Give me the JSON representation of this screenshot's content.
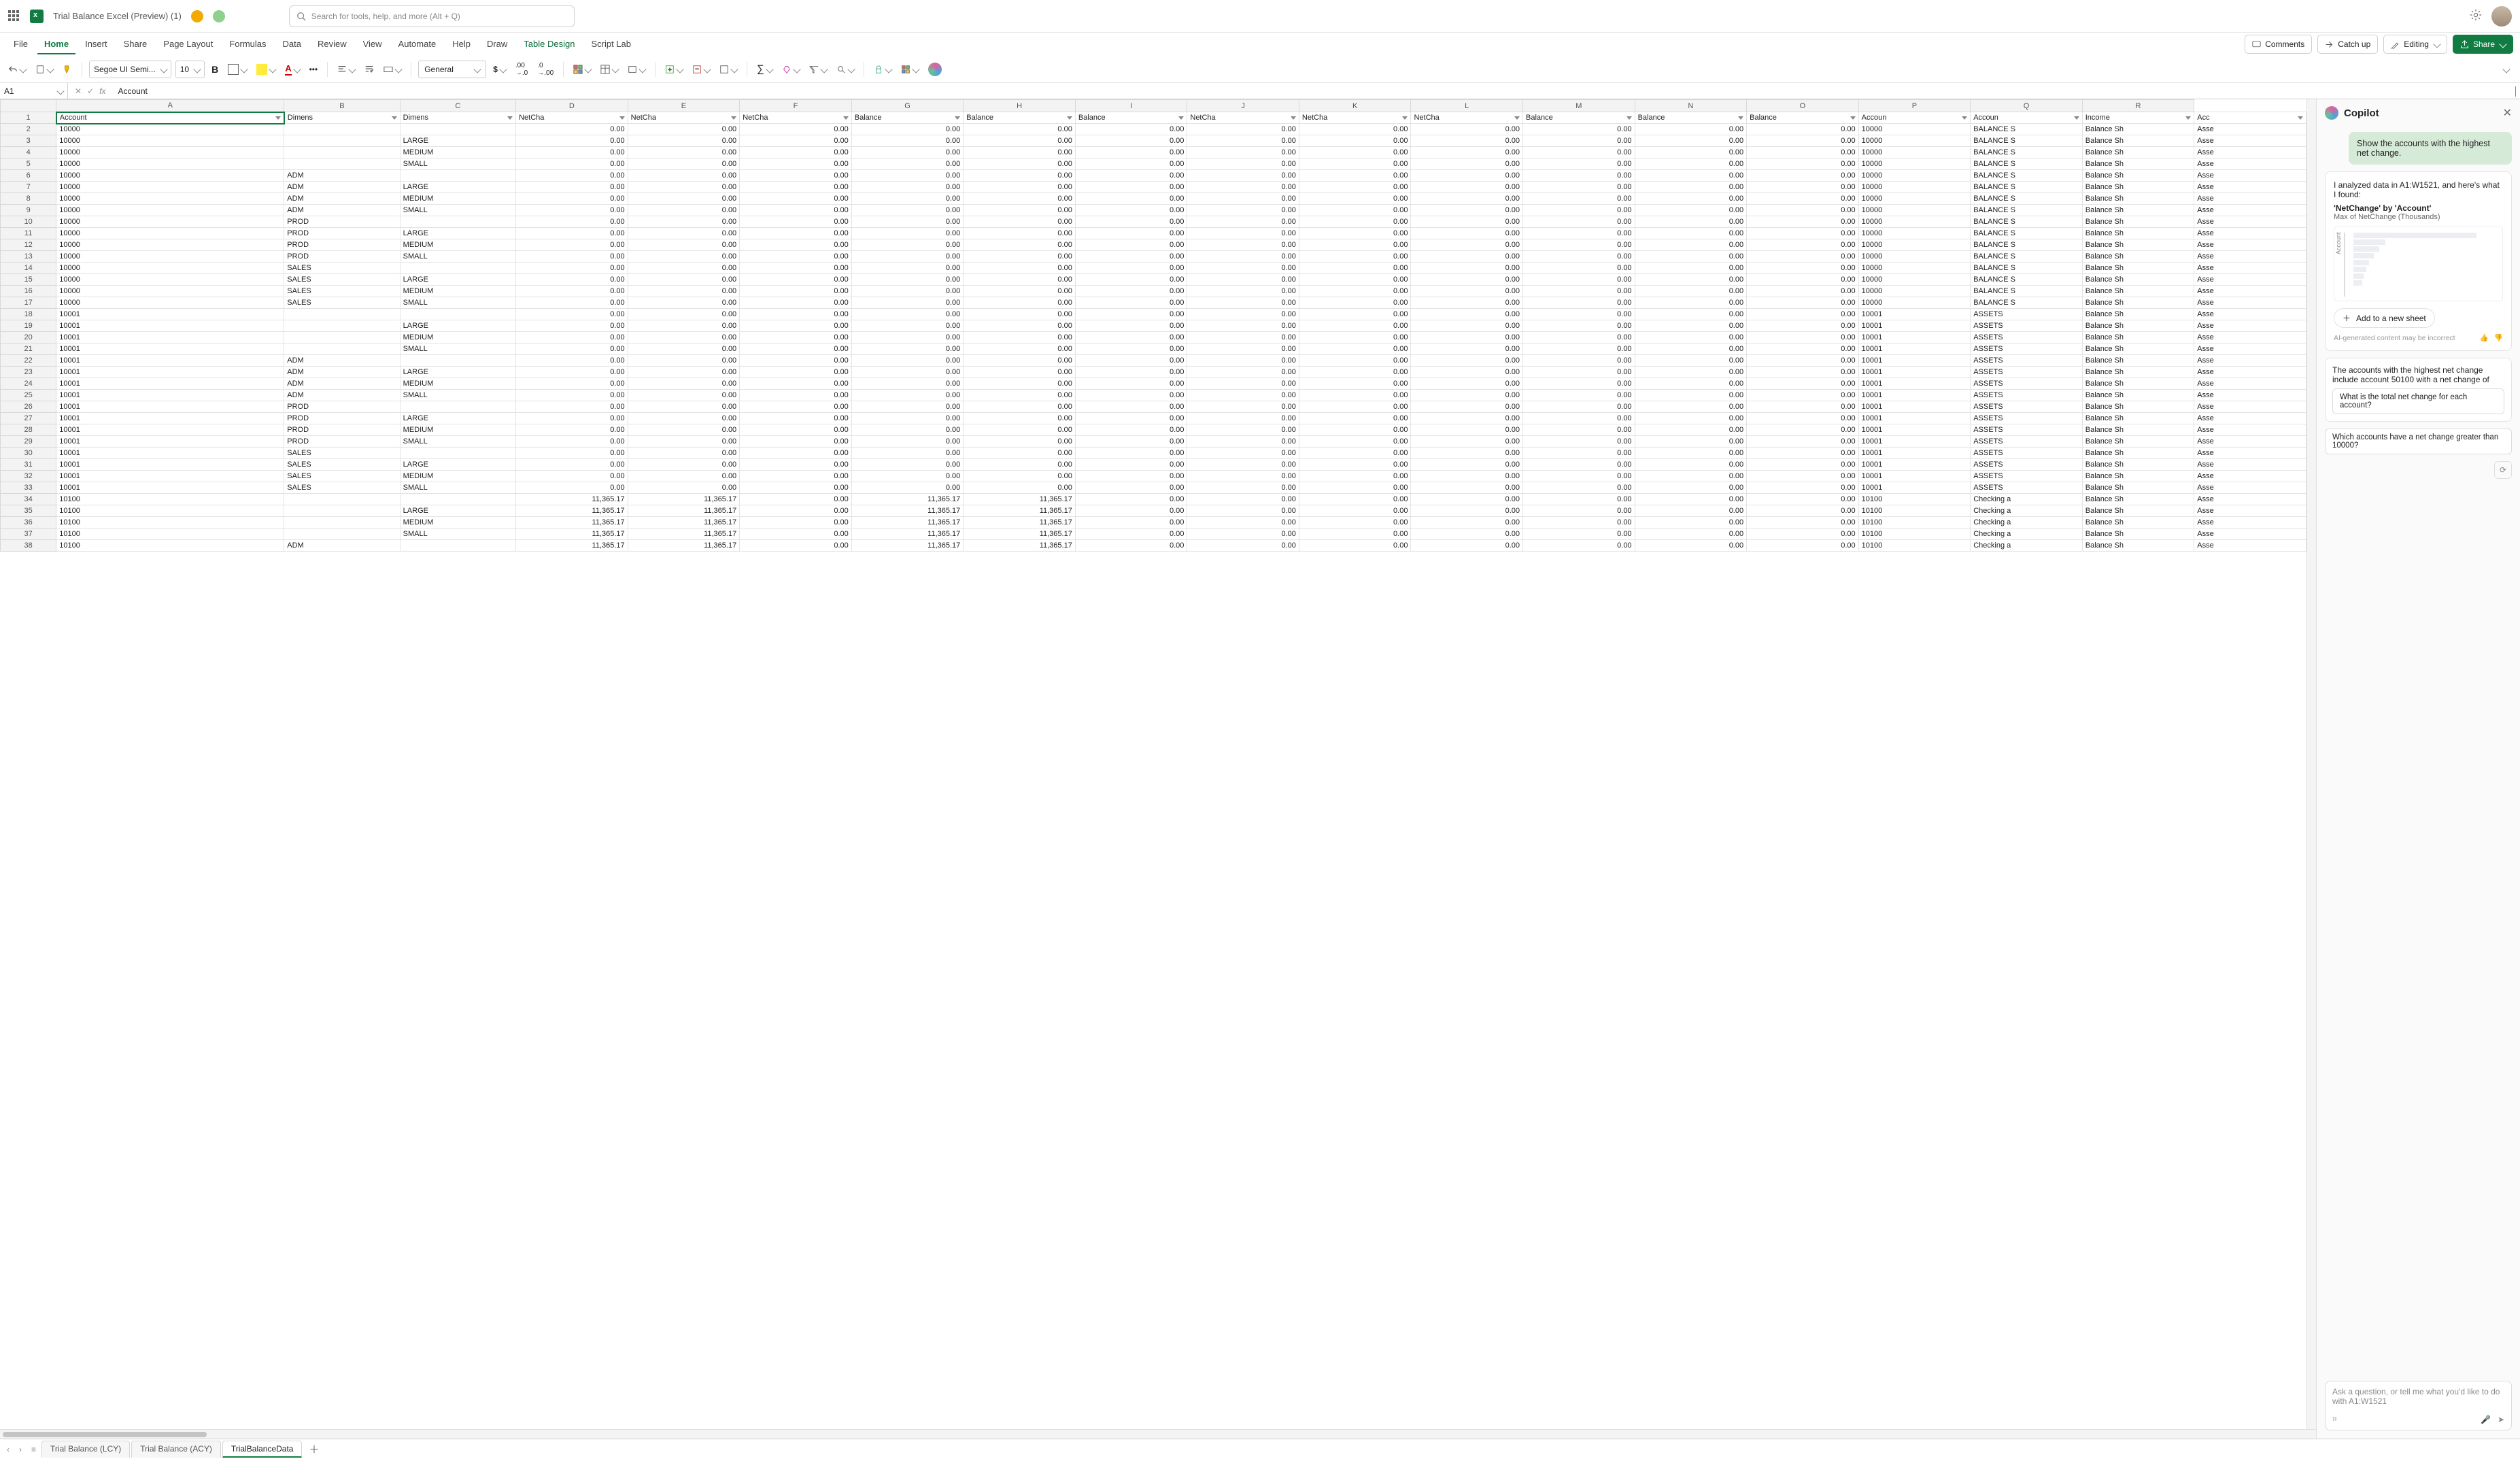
{
  "titlebar": {
    "doc_title": "Trial Balance Excel (Preview) (1)",
    "search_placeholder": "Search for tools, help, and more (Alt + Q)"
  },
  "ribbon": {
    "tabs": [
      "File",
      "Home",
      "Insert",
      "Share",
      "Page Layout",
      "Formulas",
      "Data",
      "Review",
      "View",
      "Automate",
      "Help",
      "Draw",
      "Table Design",
      "Script Lab"
    ],
    "active": "Home",
    "comments": "Comments",
    "catch_up": "Catch up",
    "editing": "Editing",
    "share": "Share"
  },
  "toolbar": {
    "font": "Segoe UI Semi...",
    "size": "10",
    "num_format": "General"
  },
  "fxbar": {
    "namebox": "A1",
    "formula": "Account"
  },
  "grid": {
    "cols": [
      "A",
      "B",
      "C",
      "D",
      "E",
      "F",
      "G",
      "H",
      "I",
      "J",
      "K",
      "L",
      "M",
      "N",
      "O",
      "P",
      "Q",
      "R"
    ],
    "header_row": [
      "Account",
      "Dimens",
      "Dimens",
      "NetCha",
      "NetCha",
      "NetCha",
      "Balance",
      "Balance",
      "Balance",
      "NetCha",
      "NetCha",
      "NetCha",
      "Balance",
      "Balance",
      "Balance",
      "Accoun",
      "Accoun",
      "Income",
      "Acc"
    ],
    "rows": [
      {
        "n": 2,
        "a": "10000",
        "b": "",
        "c": "",
        "p": "10000",
        "q": "BALANCE S",
        "r": "Balance Sh",
        "s": "Asse"
      },
      {
        "n": 3,
        "a": "10000",
        "b": "",
        "c": "LARGE",
        "p": "10000",
        "q": "BALANCE S",
        "r": "Balance Sh",
        "s": "Asse"
      },
      {
        "n": 4,
        "a": "10000",
        "b": "",
        "c": "MEDIUM",
        "p": "10000",
        "q": "BALANCE S",
        "r": "Balance Sh",
        "s": "Asse"
      },
      {
        "n": 5,
        "a": "10000",
        "b": "",
        "c": "SMALL",
        "p": "10000",
        "q": "BALANCE S",
        "r": "Balance Sh",
        "s": "Asse"
      },
      {
        "n": 6,
        "a": "10000",
        "b": "ADM",
        "c": "",
        "p": "10000",
        "q": "BALANCE S",
        "r": "Balance Sh",
        "s": "Asse"
      },
      {
        "n": 7,
        "a": "10000",
        "b": "ADM",
        "c": "LARGE",
        "p": "10000",
        "q": "BALANCE S",
        "r": "Balance Sh",
        "s": "Asse"
      },
      {
        "n": 8,
        "a": "10000",
        "b": "ADM",
        "c": "MEDIUM",
        "p": "10000",
        "q": "BALANCE S",
        "r": "Balance Sh",
        "s": "Asse"
      },
      {
        "n": 9,
        "a": "10000",
        "b": "ADM",
        "c": "SMALL",
        "p": "10000",
        "q": "BALANCE S",
        "r": "Balance Sh",
        "s": "Asse"
      },
      {
        "n": 10,
        "a": "10000",
        "b": "PROD",
        "c": "",
        "p": "10000",
        "q": "BALANCE S",
        "r": "Balance Sh",
        "s": "Asse"
      },
      {
        "n": 11,
        "a": "10000",
        "b": "PROD",
        "c": "LARGE",
        "p": "10000",
        "q": "BALANCE S",
        "r": "Balance Sh",
        "s": "Asse"
      },
      {
        "n": 12,
        "a": "10000",
        "b": "PROD",
        "c": "MEDIUM",
        "p": "10000",
        "q": "BALANCE S",
        "r": "Balance Sh",
        "s": "Asse"
      },
      {
        "n": 13,
        "a": "10000",
        "b": "PROD",
        "c": "SMALL",
        "p": "10000",
        "q": "BALANCE S",
        "r": "Balance Sh",
        "s": "Asse"
      },
      {
        "n": 14,
        "a": "10000",
        "b": "SALES",
        "c": "",
        "p": "10000",
        "q": "BALANCE S",
        "r": "Balance Sh",
        "s": "Asse"
      },
      {
        "n": 15,
        "a": "10000",
        "b": "SALES",
        "c": "LARGE",
        "p": "10000",
        "q": "BALANCE S",
        "r": "Balance Sh",
        "s": "Asse"
      },
      {
        "n": 16,
        "a": "10000",
        "b": "SALES",
        "c": "MEDIUM",
        "p": "10000",
        "q": "BALANCE S",
        "r": "Balance Sh",
        "s": "Asse"
      },
      {
        "n": 17,
        "a": "10000",
        "b": "SALES",
        "c": "SMALL",
        "p": "10000",
        "q": "BALANCE S",
        "r": "Balance Sh",
        "s": "Asse"
      },
      {
        "n": 18,
        "a": "10001",
        "b": "",
        "c": "",
        "p": "10001",
        "q": "ASSETS",
        "r": "Balance Sh",
        "s": "Asse"
      },
      {
        "n": 19,
        "a": "10001",
        "b": "",
        "c": "LARGE",
        "p": "10001",
        "q": "ASSETS",
        "r": "Balance Sh",
        "s": "Asse"
      },
      {
        "n": 20,
        "a": "10001",
        "b": "",
        "c": "MEDIUM",
        "p": "10001",
        "q": "ASSETS",
        "r": "Balance Sh",
        "s": "Asse"
      },
      {
        "n": 21,
        "a": "10001",
        "b": "",
        "c": "SMALL",
        "p": "10001",
        "q": "ASSETS",
        "r": "Balance Sh",
        "s": "Asse"
      },
      {
        "n": 22,
        "a": "10001",
        "b": "ADM",
        "c": "",
        "p": "10001",
        "q": "ASSETS",
        "r": "Balance Sh",
        "s": "Asse"
      },
      {
        "n": 23,
        "a": "10001",
        "b": "ADM",
        "c": "LARGE",
        "p": "10001",
        "q": "ASSETS",
        "r": "Balance Sh",
        "s": "Asse"
      },
      {
        "n": 24,
        "a": "10001",
        "b": "ADM",
        "c": "MEDIUM",
        "p": "10001",
        "q": "ASSETS",
        "r": "Balance Sh",
        "s": "Asse"
      },
      {
        "n": 25,
        "a": "10001",
        "b": "ADM",
        "c": "SMALL",
        "p": "10001",
        "q": "ASSETS",
        "r": "Balance Sh",
        "s": "Asse"
      },
      {
        "n": 26,
        "a": "10001",
        "b": "PROD",
        "c": "",
        "p": "10001",
        "q": "ASSETS",
        "r": "Balance Sh",
        "s": "Asse"
      },
      {
        "n": 27,
        "a": "10001",
        "b": "PROD",
        "c": "LARGE",
        "p": "10001",
        "q": "ASSETS",
        "r": "Balance Sh",
        "s": "Asse"
      },
      {
        "n": 28,
        "a": "10001",
        "b": "PROD",
        "c": "MEDIUM",
        "p": "10001",
        "q": "ASSETS",
        "r": "Balance Sh",
        "s": "Asse"
      },
      {
        "n": 29,
        "a": "10001",
        "b": "PROD",
        "c": "SMALL",
        "p": "10001",
        "q": "ASSETS",
        "r": "Balance Sh",
        "s": "Asse"
      },
      {
        "n": 30,
        "a": "10001",
        "b": "SALES",
        "c": "",
        "p": "10001",
        "q": "ASSETS",
        "r": "Balance Sh",
        "s": "Asse"
      },
      {
        "n": 31,
        "a": "10001",
        "b": "SALES",
        "c": "LARGE",
        "p": "10001",
        "q": "ASSETS",
        "r": "Balance Sh",
        "s": "Asse"
      },
      {
        "n": 32,
        "a": "10001",
        "b": "SALES",
        "c": "MEDIUM",
        "p": "10001",
        "q": "ASSETS",
        "r": "Balance Sh",
        "s": "Asse"
      },
      {
        "n": 33,
        "a": "10001",
        "b": "SALES",
        "c": "SMALL",
        "p": "10001",
        "q": "ASSETS",
        "r": "Balance Sh",
        "s": "Asse"
      },
      {
        "n": 34,
        "a": "10100",
        "b": "",
        "c": "",
        "d": "11,365.17",
        "e": "11,365.17",
        "f": "0.00",
        "g": "11,365.17",
        "h": "11,365.17",
        "p": "10100",
        "q": "Checking a",
        "r": "Balance Sh",
        "s": "Asse"
      },
      {
        "n": 35,
        "a": "10100",
        "b": "",
        "c": "LARGE",
        "d": "11,365.17",
        "e": "11,365.17",
        "f": "0.00",
        "g": "11,365.17",
        "h": "11,365.17",
        "p": "10100",
        "q": "Checking a",
        "r": "Balance Sh",
        "s": "Asse"
      },
      {
        "n": 36,
        "a": "10100",
        "b": "",
        "c": "MEDIUM",
        "d": "11,365.17",
        "e": "11,365.17",
        "f": "0.00",
        "g": "11,365.17",
        "h": "11,365.17",
        "p": "10100",
        "q": "Checking a",
        "r": "Balance Sh",
        "s": "Asse"
      },
      {
        "n": 37,
        "a": "10100",
        "b": "",
        "c": "SMALL",
        "d": "11,365.17",
        "e": "11,365.17",
        "f": "0.00",
        "g": "11,365.17",
        "h": "11,365.17",
        "p": "10100",
        "q": "Checking a",
        "r": "Balance Sh",
        "s": "Asse"
      },
      {
        "n": 38,
        "a": "10100",
        "b": "ADM",
        "c": "",
        "d": "11,365.17",
        "e": "11,365.17",
        "f": "0.00",
        "g": "11,365.17",
        "h": "11,365.17",
        "p": "10100",
        "q": "Checking a",
        "r": "Balance Sh",
        "s": "Asse"
      }
    ],
    "zero": "0.00"
  },
  "sheets": {
    "tabs": [
      "Trial Balance (LCY)",
      "Trial Balance (ACY)",
      "TrialBalanceData"
    ],
    "active": "TrialBalanceData"
  },
  "copilot": {
    "title": "Copilot",
    "user_msg": "Show the accounts with the highest net change.",
    "analysis_intro": "I analyzed data in A1:W1521, and here's what I found:",
    "insight_title": "'NetChange' by 'Account'",
    "insight_sub": "Max of NetChange (Thousands)",
    "add_sheet": "Add to a new sheet",
    "disclaimer": "AI-generated content may be incorrect",
    "summary": "The accounts with the highest net change include account 50100 with a net change of",
    "suggestion1": "What is the total net change for each account?",
    "suggestion2": "Which accounts have a net change greater than 10000?",
    "input_placeholder": "Ask a question, or tell me what you'd like to do with A1:W1521",
    "chart_ylabel": "Account"
  }
}
